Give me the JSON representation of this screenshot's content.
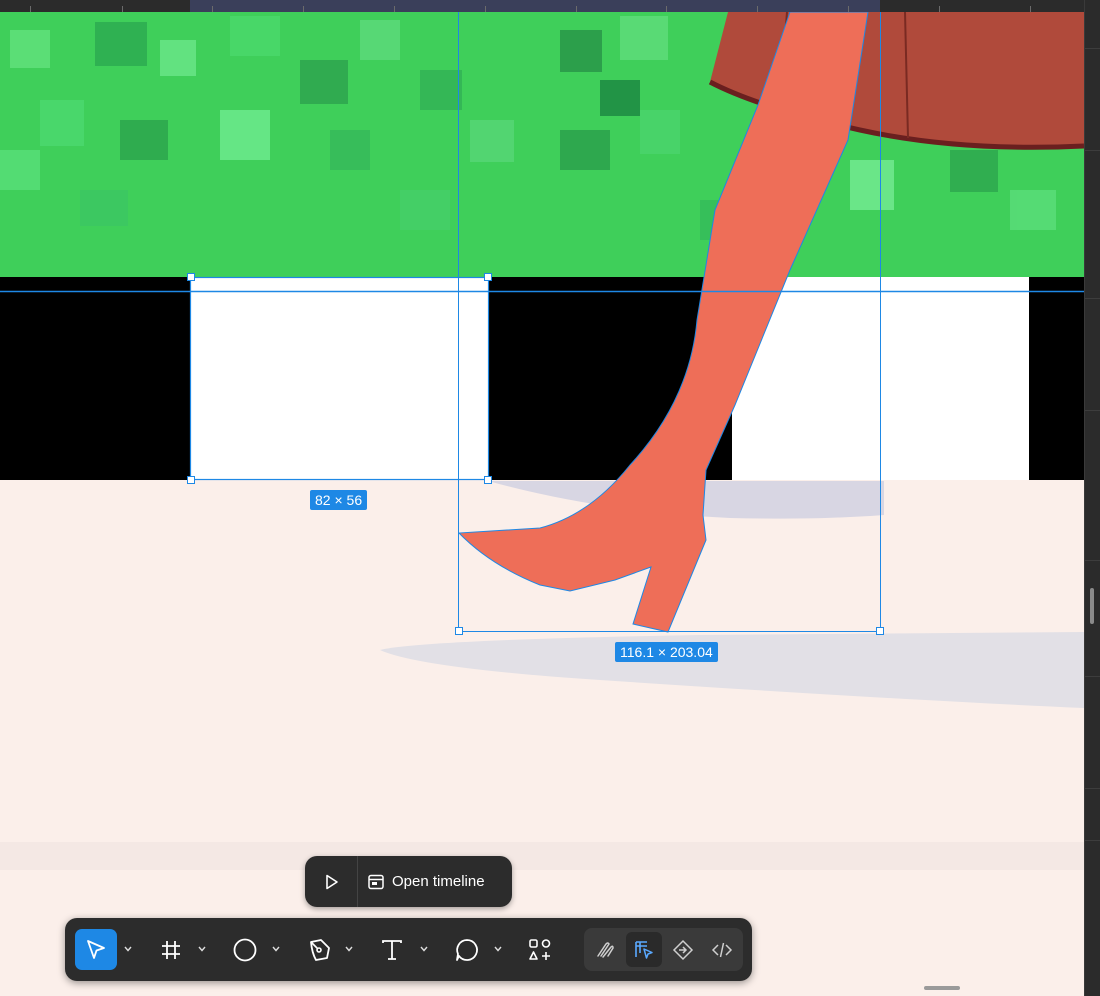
{
  "colors": {
    "canvas_bg": "#fbefea",
    "selection_blue": "#1e88e5",
    "leg": "#ee6e58",
    "skirt": "#b04a3b",
    "grass": "#3fcf5a",
    "toolbar_bg": "#2c2c2c"
  },
  "canvas": {
    "selection_small_dims": "82 × 56",
    "selection_boot_dims": "116.1 × 203.04"
  },
  "timeline": {
    "play_icon": "play-icon",
    "open_label": "Open timeline",
    "open_icon": "timeline-icon"
  },
  "toolbar": {
    "tools": [
      {
        "name": "move",
        "icon": "cursor-arrow-icon",
        "active": true
      },
      {
        "name": "frame",
        "icon": "frame-hash-icon"
      },
      {
        "name": "shape",
        "icon": "circle-icon"
      },
      {
        "name": "pen",
        "icon": "pen-nib-icon"
      },
      {
        "name": "text",
        "icon": "text-icon"
      },
      {
        "name": "comment",
        "icon": "comment-bubble-icon"
      },
      {
        "name": "actions",
        "icon": "shapes-plus-icon"
      }
    ],
    "modes": [
      {
        "name": "draw",
        "icon": "draw-squiggle-icon"
      },
      {
        "name": "design",
        "icon": "design-mode-icon",
        "active": true
      },
      {
        "name": "prototype",
        "icon": "prototype-diamond-icon"
      },
      {
        "name": "dev",
        "icon": "code-brackets-icon"
      }
    ]
  }
}
